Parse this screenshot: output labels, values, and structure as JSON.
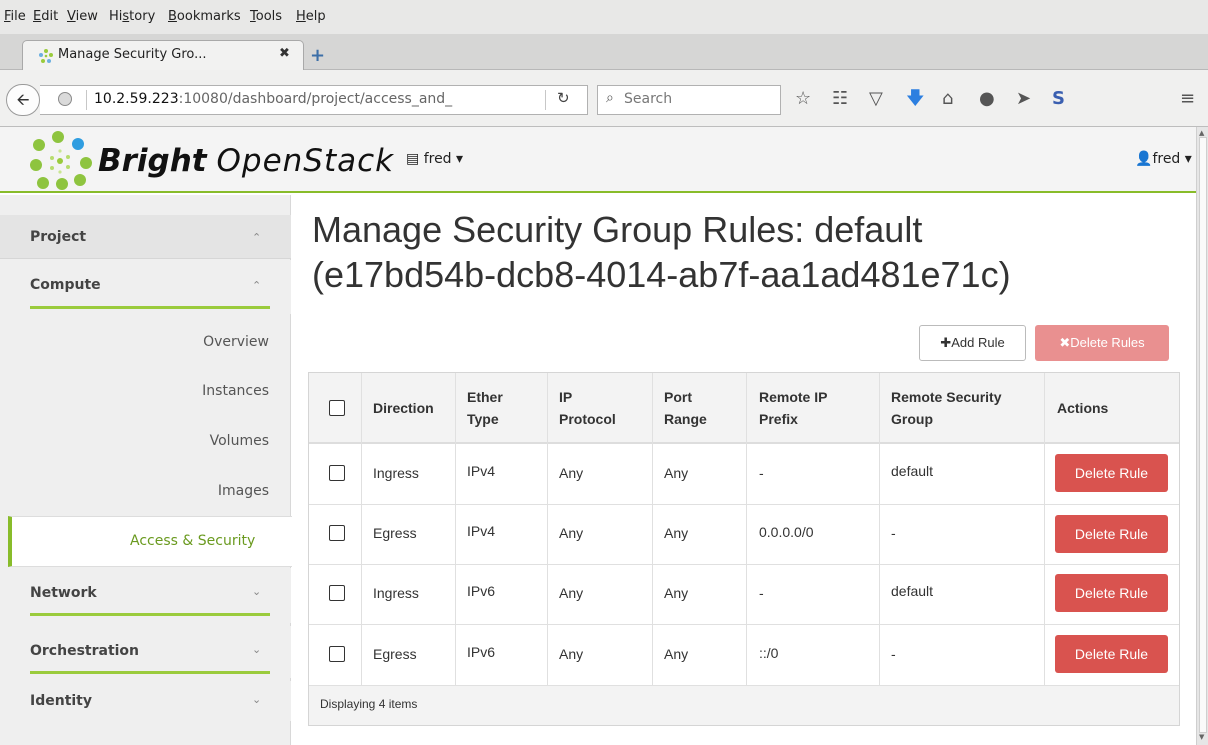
{
  "browser": {
    "menu": [
      {
        "prefix": "",
        "key": "F",
        "rest": "ile"
      },
      {
        "prefix": "",
        "key": "E",
        "rest": "dit"
      },
      {
        "prefix": "",
        "key": "V",
        "rest": "iew"
      },
      {
        "prefix": "Hi",
        "key": "s",
        "rest": "tory"
      },
      {
        "prefix": "",
        "key": "B",
        "rest": "ookmarks"
      },
      {
        "prefix": "",
        "key": "T",
        "rest": "ools"
      },
      {
        "prefix": "",
        "key": "H",
        "rest": "elp"
      }
    ],
    "tab_title": "Manage Security Gro...",
    "tab_close": "✖",
    "new_tab": "+",
    "url_host": "10.2.59.223",
    "url_rest": ":10080/dashboard/project/access_and_",
    "search_placeholder": "Search"
  },
  "header": {
    "brand_bold": "Bright",
    "brand_light": "OpenStack",
    "project_switch": "fred",
    "user": "fred"
  },
  "sidebar": {
    "sections": {
      "project": "Project",
      "compute": "Compute",
      "network": "Network",
      "orchestration": "Orchestration",
      "identity": "Identity"
    },
    "items": [
      "Overview",
      "Instances",
      "Volumes",
      "Images",
      "Access & Security"
    ]
  },
  "main": {
    "title_line1": "Manage Security Group Rules: default",
    "title_line2": "(e17bd54b-dcb8-4014-ab7f-aa1ad481e71c)",
    "add_rule": "Add Rule",
    "delete_rules": "Delete Rules",
    "columns": {
      "direction": "Direction",
      "ether_1": "Ether",
      "ether_2": "Type",
      "ip_1": "IP",
      "ip_2": "Protocol",
      "port_1": "Port",
      "port_2": "Range",
      "rip_1": "Remote IP",
      "rip_2": "Prefix",
      "rsg_1": "Remote Security",
      "rsg_2": "Group",
      "actions": "Actions"
    },
    "rows": [
      {
        "direction": "Ingress",
        "ether": "IPv4",
        "protocol": "Any",
        "port": "Any",
        "remote_ip": "-",
        "remote_group": "default",
        "action": "Delete Rule"
      },
      {
        "direction": "Egress",
        "ether": "IPv4",
        "protocol": "Any",
        "port": "Any",
        "remote_ip": "0.0.0.0/0",
        "remote_group": "-",
        "action": "Delete Rule"
      },
      {
        "direction": "Ingress",
        "ether": "IPv6",
        "protocol": "Any",
        "port": "Any",
        "remote_ip": "-",
        "remote_group": "default",
        "action": "Delete Rule"
      },
      {
        "direction": "Egress",
        "ether": "IPv6",
        "protocol": "Any",
        "port": "Any",
        "remote_ip": "::/0",
        "remote_group": "-",
        "action": "Delete Rule"
      }
    ],
    "footer": "Displaying 4 items"
  },
  "colors": {
    "accent_green": "#88bc2a",
    "danger": "#d9534f",
    "danger_disabled": "#e99090"
  }
}
